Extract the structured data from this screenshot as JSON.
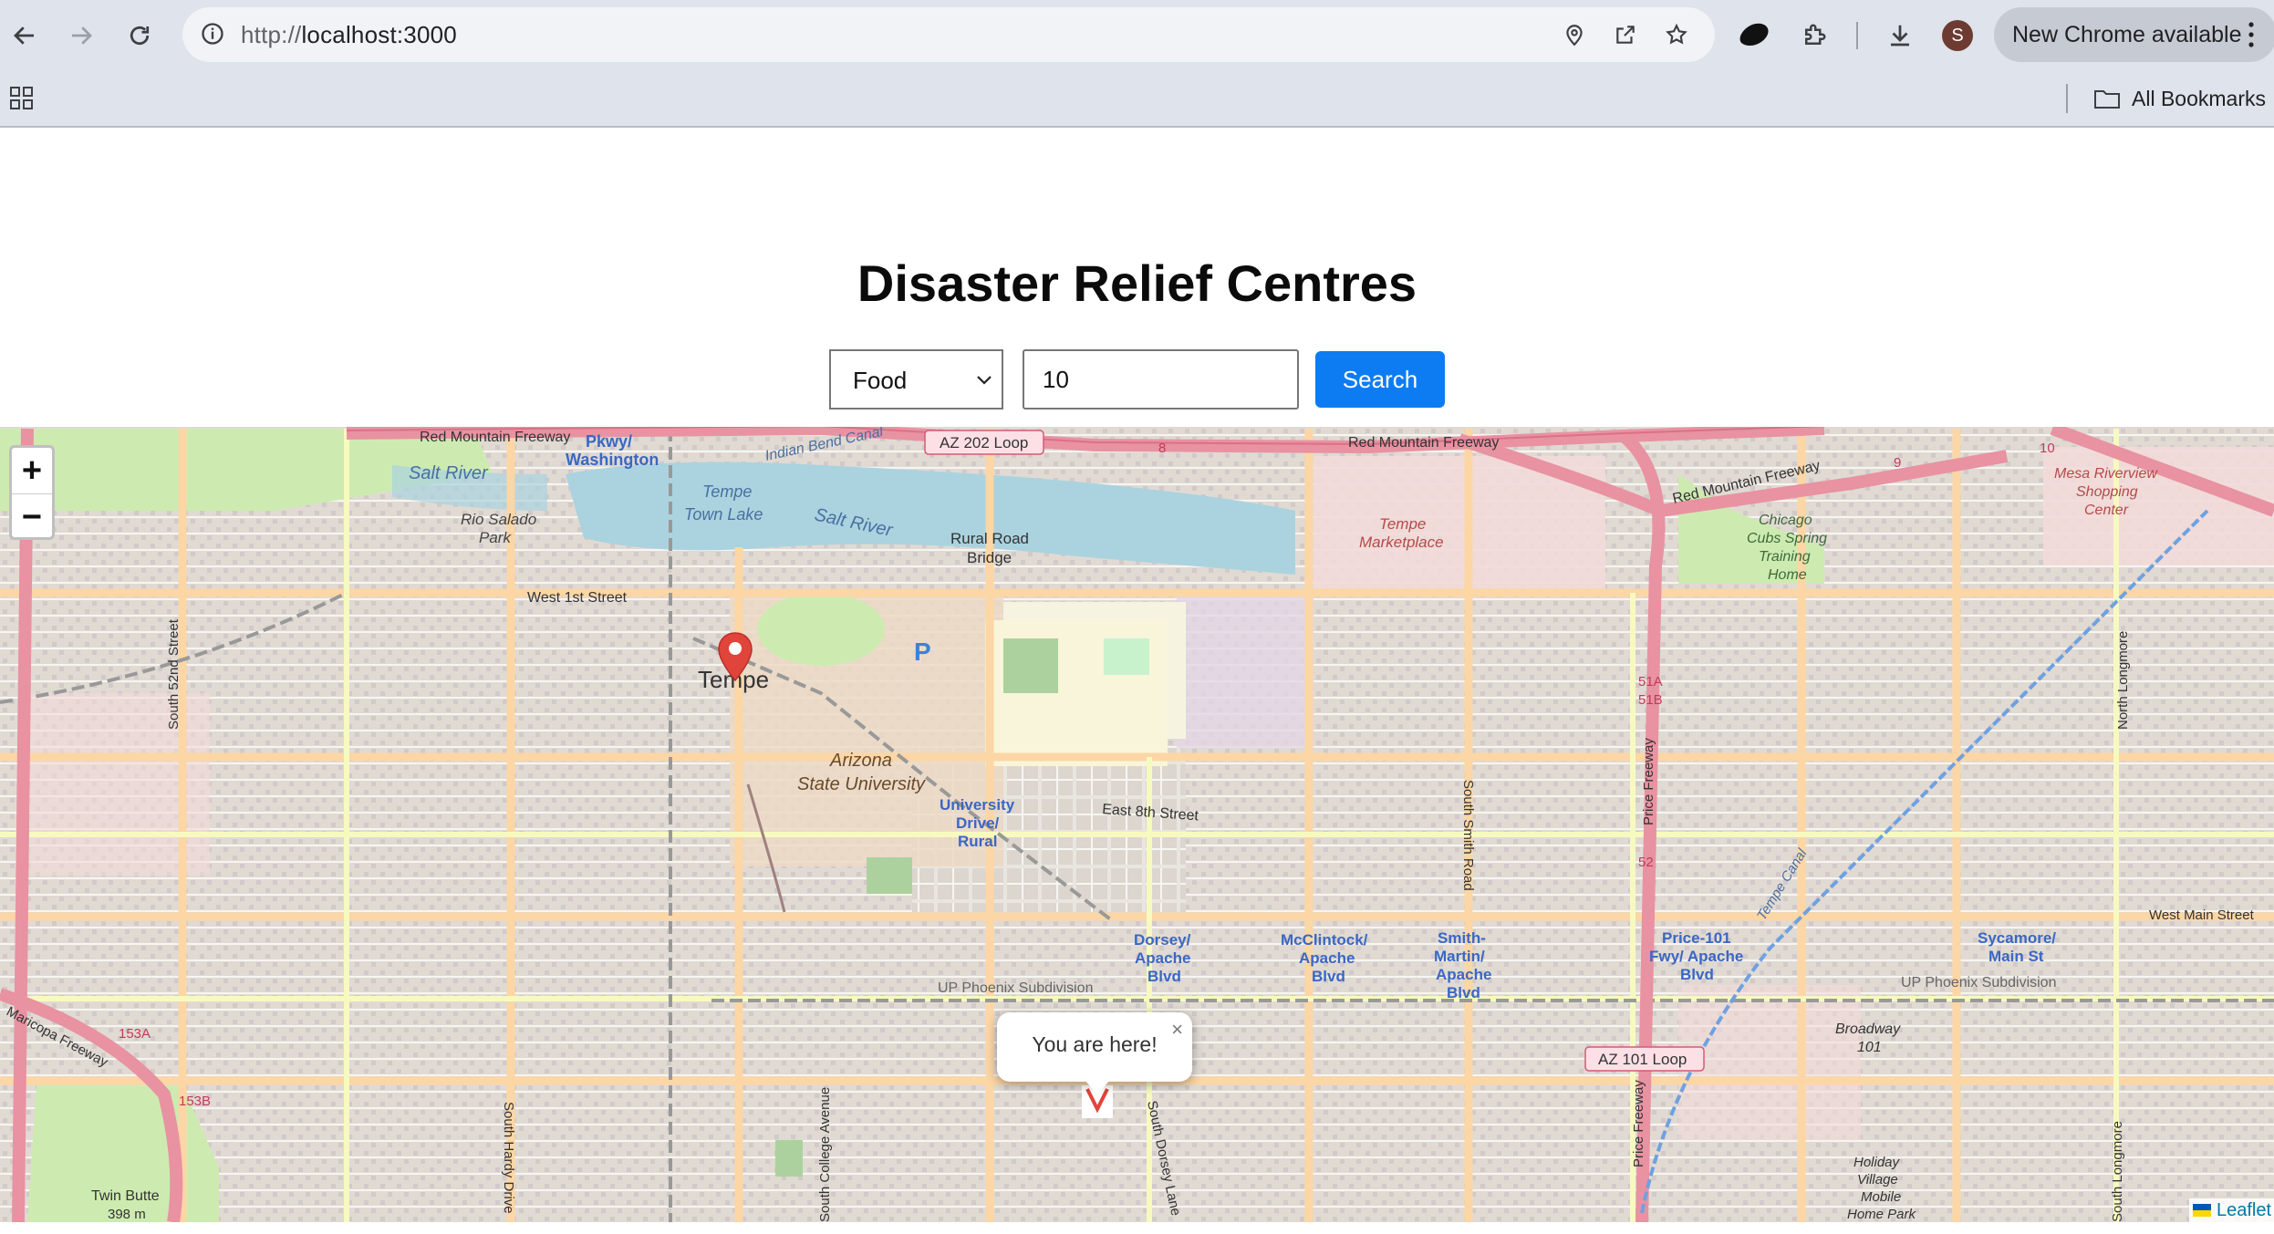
{
  "browser": {
    "url_prefix": "http://",
    "url_host": "localhost:3000",
    "update_label": "New Chrome available",
    "avatar_initial": "S",
    "bookmarks_label": "All Bookmarks"
  },
  "page": {
    "title": "Disaster Relief Centres",
    "category_selected": "Food",
    "radius_value": "10",
    "search_label": "Search"
  },
  "map": {
    "zoom_in": "+",
    "zoom_out": "−",
    "popup_text": "You are here!",
    "popup_close": "×",
    "attribution": "Leaflet",
    "labels": {
      "salt_river_w": "Salt River",
      "salt_river_e": "Salt River",
      "rio_salado": "Rio Salado",
      "park": "Park",
      "pkwy": "Pkwy/",
      "washington": "Washington",
      "tempe_town_lake_1": "Tempe",
      "tempe_town_lake_2": "Town Lake",
      "indian_bend": "Indian Bend Canal",
      "az202": "AZ 202 Loop",
      "red_mtn_w": "Red Mountain Freeway",
      "red_mtn_n": "Red Mountain Freeway",
      "red_mtn_e": "Red Mountain Freeway",
      "rural_road_1": "Rural Road",
      "rural_road_2": "Bridge",
      "tempe_mkt_1": "Tempe",
      "tempe_mkt_2": "Marketplace",
      "chicago_1": "Chicago",
      "chicago_2": "Cubs Spring",
      "chicago_3": "Training",
      "chicago_4": "Home",
      "mesa_1": "Mesa Riverview",
      "mesa_2": "Shopping",
      "mesa_3": "Center",
      "w1st": "West 1st Street",
      "s52": "South 52nd Street",
      "tempe_city": "Tempe",
      "asu_1": "Arizona",
      "asu_2": "State University",
      "ud_1": "University",
      "ud_2": "Drive/",
      "ud_3": "Rural",
      "e8th": "East 8th Street",
      "ssmith": "South Smith Road",
      "price_fwy_n": "Price Freeway",
      "price_fwy_s": "Price Freeway",
      "n_longmore": "North Longmore",
      "s_longmore": "South Longmore",
      "w_main": "West Main Street",
      "dorsey_1": "Dorsey/",
      "dorsey_2": "Apache",
      "dorsey_3": "Blvd",
      "mcc_1": "McClintock/",
      "mcc_2": "Apache",
      "mcc_3": "Blvd",
      "smith_1": "Smith-",
      "smith_2": "Martin/",
      "smith_3": "Apache",
      "smith_4": "Blvd",
      "p101_1": "Price-101",
      "p101_2": "Fwy/ Apache",
      "p101_3": "Blvd",
      "syc_1": "Sycamore/",
      "syc_2": "Main St",
      "up_phx_w": "UP Phoenix Subdivision",
      "up_phx_e": "UP Phoenix Subdivision",
      "az101": "AZ 101 Loop",
      "broadway_1": "Broadway",
      "broadway_2": "101",
      "maricopa": "Maricopa Freeway",
      "twin_1": "Twin Butte",
      "twin_2": "398 m",
      "s_hardy": "South Hardy Drive",
      "s_college": "South College Avenue",
      "s_dorsey": "South Dorsey Lane",
      "holiday_1": "Holiday",
      "holiday_2": "Village",
      "holiday_3": "Mobile",
      "holiday_4": "Home Park",
      "tempe_canal": "Tempe Canal",
      "n51a": "51A",
      "n51b": "51B",
      "n52": "52",
      "n153a": "153A",
      "n153b": "153B",
      "n8": "8",
      "n9": "9",
      "n10": "10",
      "p_sign": "P"
    }
  },
  "colors": {
    "search_button": "#0d7cf2",
    "marker": "#e0443a",
    "water": "#aad3df",
    "motorway": "#e892a2",
    "primary_road": "#fcd6a4"
  }
}
